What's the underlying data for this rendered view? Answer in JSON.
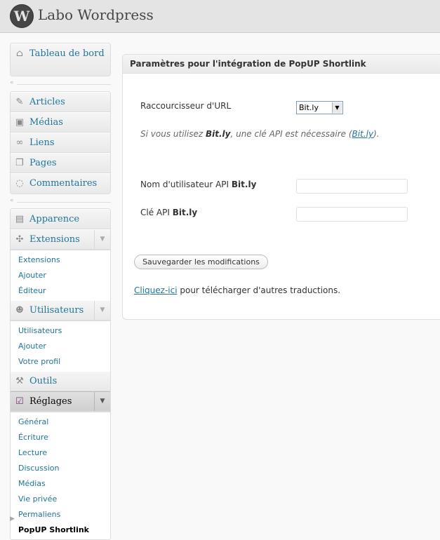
{
  "header": {
    "logo_glyph": "W",
    "site_title": "Labo Wordpress"
  },
  "menu": {
    "dashboard": {
      "label": "Tableau de bord",
      "icon": "house-icon"
    },
    "group1": [
      {
        "label": "Articles",
        "icon": "pushpin-icon"
      },
      {
        "label": "Médias",
        "icon": "media-icon"
      },
      {
        "label": "Liens",
        "icon": "link-icon"
      },
      {
        "label": "Pages",
        "icon": "pages-icon"
      },
      {
        "label": "Commentaires",
        "icon": "comment-icon"
      }
    ],
    "appearance": {
      "label": "Apparence",
      "icon": "appearance-icon"
    },
    "extensions": {
      "label": "Extensions",
      "icon": "plugin-icon",
      "sub": [
        "Extensions",
        "Ajouter",
        "Éditeur"
      ]
    },
    "users": {
      "label": "Utilisateurs",
      "icon": "users-icon",
      "sub": [
        "Utilisateurs",
        "Ajouter",
        "Votre profil"
      ]
    },
    "tools": {
      "label": "Outils",
      "icon": "tools-icon"
    },
    "settings": {
      "label": "Réglages",
      "icon": "settings-icon",
      "sub": [
        "Général",
        "Écriture",
        "Lecture",
        "Discussion",
        "Médias",
        "Vie privée",
        "Permaliens",
        "PopUP Shortlink"
      ],
      "current_sub": "PopUP Shortlink"
    }
  },
  "panel": {
    "title": "Paramètres pour l'intégration de PopUP Shortlink",
    "shortener_label": "Raccourcisseur d'URL",
    "shortener_value": "Bit.ly",
    "note_prefix": "Si vous utilisez ",
    "note_bold": "Bit.ly",
    "note_middle": ", une clé API est nécessaire (",
    "note_link": "Bit.ly",
    "note_suffix": ").",
    "username_label_prefix": "Nom d'utilisateur API ",
    "username_label_bold": "Bit.ly",
    "username_value": "",
    "apikey_label_prefix": "Clé API ",
    "apikey_label_bold": "Bit.ly",
    "apikey_value": "",
    "save_button": "Sauvegarder les modifications",
    "footer_link": "Cliquez-ici",
    "footer_text": " pour télécharger d'autres traductions."
  },
  "colors": {
    "link": "#21759b",
    "header_bg": "#e4e4e4",
    "page_bg": "#f9f9f9"
  }
}
